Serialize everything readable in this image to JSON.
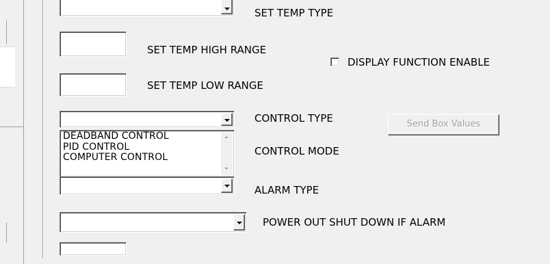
{
  "labels": {
    "set_temp_type": "SET TEMP TYPE",
    "set_temp_high_range": "SET TEMP HIGH RANGE",
    "set_temp_low_range": "SET TEMP LOW RANGE",
    "display_function_enable": "DISPLAY FUNCTION ENABLE",
    "control_type": "CONTROL TYPE",
    "control_mode": "CONTROL MODE",
    "alarm_type": "ALARM TYPE",
    "power_out_shut_down": "POWER OUT SHUT DOWN IF ALARM"
  },
  "inputs": {
    "set_temp_type_value": "",
    "set_temp_high_value": "",
    "set_temp_low_value": "",
    "control_type_value": "",
    "alarm_type_value": "",
    "power_out_value": ""
  },
  "control_mode_list": [
    "DEADBAND CONTROL",
    "PID CONTROL",
    "COMPUTER CONTROL"
  ],
  "checkbox": {
    "display_function_enable_checked": false
  },
  "buttons": {
    "send_box_values": "Send Box Values",
    "send_box_values_enabled": false
  },
  "icons": {
    "combo_arrow": "chevron-down-icon",
    "scroll_up": "scroll-up-icon",
    "scroll_down": "scroll-down-icon"
  },
  "colors": {
    "window_bg": "#f0f0f0",
    "field_bg": "#ffffff",
    "disabled_text": "#a0a0a0"
  }
}
